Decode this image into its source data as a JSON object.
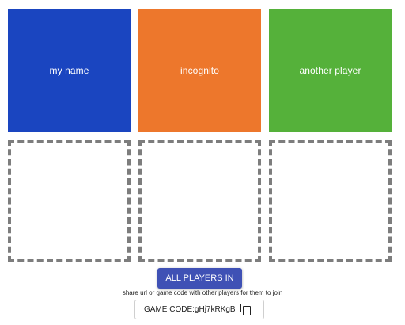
{
  "players": [
    {
      "name": "my name",
      "color": "#1a45c0"
    },
    {
      "name": "incognito",
      "color": "#ed772c"
    },
    {
      "name": "another player",
      "color": "#55b13a"
    }
  ],
  "empty_slot_color": "#7d7d7d",
  "all_players_in_label": "ALL PLAYERS IN",
  "button_color": "#3f51b5",
  "share_hint": "share url or game code with other players for them to join",
  "game_code": {
    "prefix": "GAME CODE:",
    "value": "gHj7kRKgB",
    "icon": "copy-icon"
  }
}
